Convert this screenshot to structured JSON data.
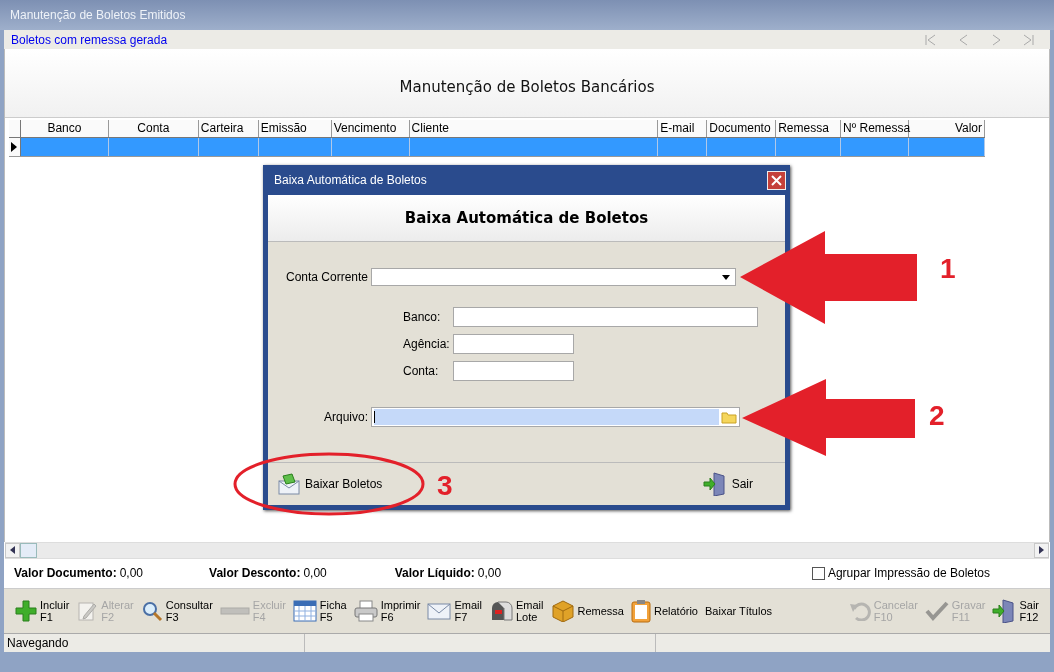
{
  "window": {
    "title": "Manutenção de Boletos Emitidos"
  },
  "filter_link": "Boletos com remessa gerada",
  "heading": "Manutenção de Boletos Bancários",
  "table": {
    "columns": [
      "Banco",
      "Conta",
      "Carteira",
      "Emissão",
      "Vencimento",
      "Cliente",
      "E-mail",
      "Documento",
      "Remessa",
      "Nº Remessa",
      "Valor"
    ],
    "rows": [
      {
        "selected": true
      }
    ]
  },
  "dialog": {
    "title": "Baixa Automática de Boletos",
    "heading": "Baixa Automática de Boletos",
    "fields": [
      {
        "kind": "combo",
        "label": "Conta Corrente"
      },
      {
        "kind": "text",
        "label": "Banco:"
      },
      {
        "kind": "text",
        "label": "Agência:"
      },
      {
        "kind": "text",
        "label": "Conta:"
      },
      {
        "kind": "file",
        "label": "Arquivo:"
      }
    ],
    "buttons": [
      {
        "label": "Baixar Boletos"
      },
      {
        "label": "Sair"
      }
    ]
  },
  "totals": [
    {
      "label": "Valor Documento:",
      "value": "0,00"
    },
    {
      "label": "Valor Desconto:",
      "value": "0,00"
    },
    {
      "label": "Valor Líquido:",
      "value": "0,00"
    }
  ],
  "group_print": {
    "label": "Agrupar Impressão de Boletos",
    "checked": false
  },
  "toolbar": [
    {
      "label": "Incluir",
      "key": "F1",
      "disabled": false
    },
    {
      "label": "Alterar",
      "key": "F2",
      "disabled": true
    },
    {
      "label": "Consultar",
      "key": "F3",
      "disabled": false
    },
    {
      "label": "Excluir",
      "key": "F4",
      "disabled": true
    },
    {
      "label": "Ficha",
      "key": "F5",
      "disabled": false
    },
    {
      "label": "Imprimir",
      "key": "F6",
      "disabled": false
    },
    {
      "label": "Email",
      "key": "F7",
      "disabled": false
    },
    {
      "label": "Email",
      "key": "Lote",
      "disabled": false
    },
    {
      "label": "Remessa",
      "disabled": false
    },
    {
      "label": "Relatório",
      "disabled": false
    },
    {
      "label": "Baixar Títulos",
      "disabled": false
    },
    {
      "label": "Cancelar",
      "key": "F10",
      "disabled": true
    },
    {
      "label": "Gravar",
      "key": "F11",
      "disabled": true
    },
    {
      "label": "Sair",
      "key": "F12",
      "disabled": false
    }
  ],
  "status_bar": {
    "text": "Navegando"
  },
  "annotations": [
    {
      "label": "1"
    },
    {
      "label": "2"
    },
    {
      "label": "3"
    }
  ]
}
